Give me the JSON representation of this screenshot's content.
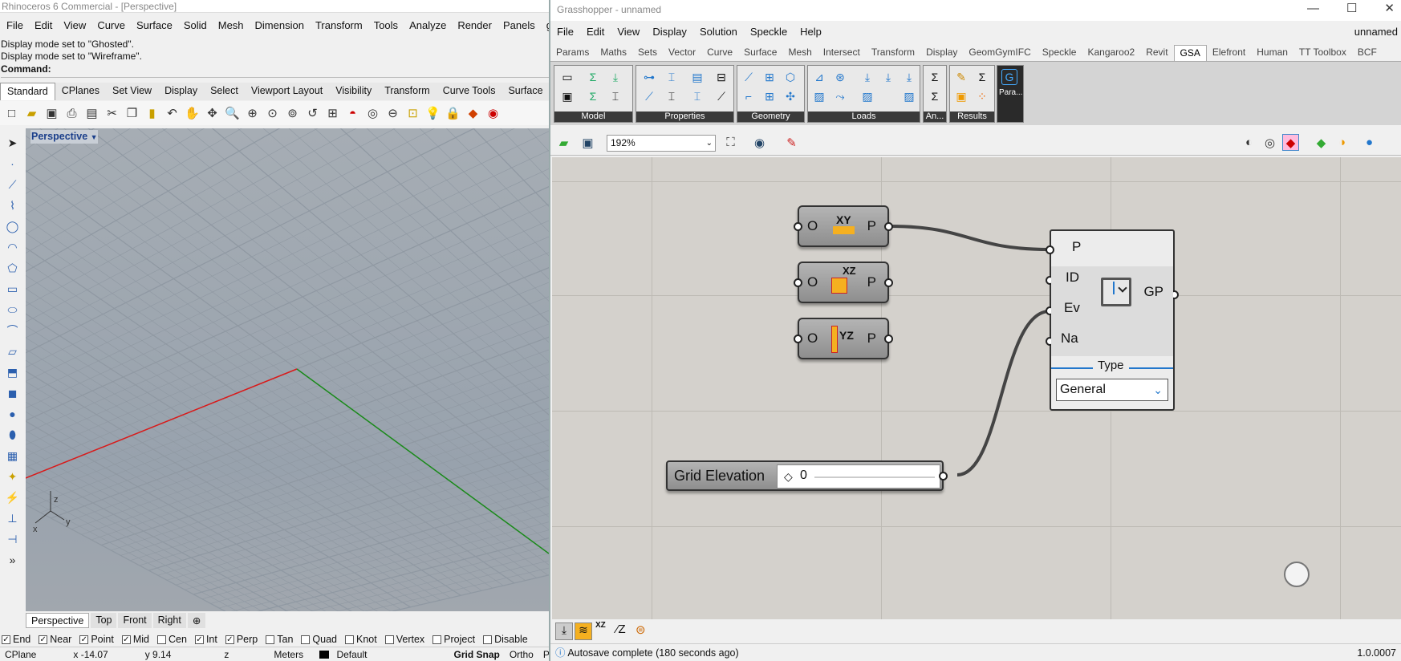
{
  "rhino": {
    "title": "Rhinoceros 6 Commercial - [Perspective]",
    "menu": [
      "File",
      "Edit",
      "View",
      "Curve",
      "Surface",
      "Solid",
      "Mesh",
      "Dimension",
      "Transform",
      "Tools",
      "Analyze",
      "Render",
      "Panels",
      "ggRhinoIFC"
    ],
    "history": [
      "Display mode set to \"Ghosted\".",
      "Display mode set to \"Wireframe\"."
    ],
    "command_label": "Command:",
    "toolbar_tabs": [
      "Standard",
      "CPlanes",
      "Set View",
      "Display",
      "Select",
      "Viewport Layout",
      "Visibility",
      "Transform",
      "Curve Tools",
      "Surface"
    ],
    "viewport_label": "Perspective",
    "view_tabs": [
      "Perspective",
      "Top",
      "Front",
      "Right"
    ],
    "osnaps": [
      {
        "label": "End",
        "checked": true
      },
      {
        "label": "Near",
        "checked": true
      },
      {
        "label": "Point",
        "checked": true
      },
      {
        "label": "Mid",
        "checked": true
      },
      {
        "label": "Cen",
        "checked": false
      },
      {
        "label": "Int",
        "checked": true
      },
      {
        "label": "Perp",
        "checked": true
      },
      {
        "label": "Tan",
        "checked": false
      },
      {
        "label": "Quad",
        "checked": false
      },
      {
        "label": "Knot",
        "checked": false
      },
      {
        "label": "Vertex",
        "checked": false
      },
      {
        "label": "Project",
        "checked": false
      },
      {
        "label": "Disable",
        "checked": false
      }
    ],
    "status": {
      "cplane": "CPlane",
      "x": "x -14.07",
      "y": "y 9.14",
      "z": "z",
      "units": "Meters",
      "layer": "Default",
      "grid_snap": "Grid Snap",
      "ortho": "Ortho",
      "planar": "Pla"
    },
    "axis_labels": {
      "z": "z",
      "y": "y",
      "x": "x"
    }
  },
  "gh": {
    "title": "Grasshopper - unnamed",
    "menu": [
      "File",
      "Edit",
      "View",
      "Display",
      "Solution",
      "Speckle",
      "Help"
    ],
    "doc_name": "unnamed",
    "tabs": [
      "Params",
      "Maths",
      "Sets",
      "Vector",
      "Curve",
      "Surface",
      "Mesh",
      "Intersect",
      "Transform",
      "Display",
      "GeomGymIFC",
      "Speckle",
      "Kangaroo2",
      "Revit",
      "GSA",
      "Elefront",
      "Human",
      "TT Toolbox",
      "BCF"
    ],
    "active_tab": "GSA",
    "ribbon_panels": [
      "Model",
      "Properties",
      "Geometry",
      "Loads",
      "An...",
      "Results"
    ],
    "param_label": "Para...",
    "zoom": "192%",
    "components": {
      "xy": {
        "in": "O",
        "out": "P",
        "icon": "XY"
      },
      "xz": {
        "in": "O",
        "out": "P",
        "icon": "XZ"
      },
      "yz": {
        "in": "O",
        "out": "P",
        "icon": "YZ"
      }
    },
    "grid_plane": {
      "inputs": [
        "P",
        "ID",
        "Ev",
        "Na"
      ],
      "output": "GP",
      "type_label": "Type",
      "type_value": "General"
    },
    "slider": {
      "label": "Grid Elevation",
      "value": "0"
    },
    "bottom_xz": "XZ",
    "status": "Autosave complete (180 seconds ago)",
    "version": "1.0.0007"
  }
}
